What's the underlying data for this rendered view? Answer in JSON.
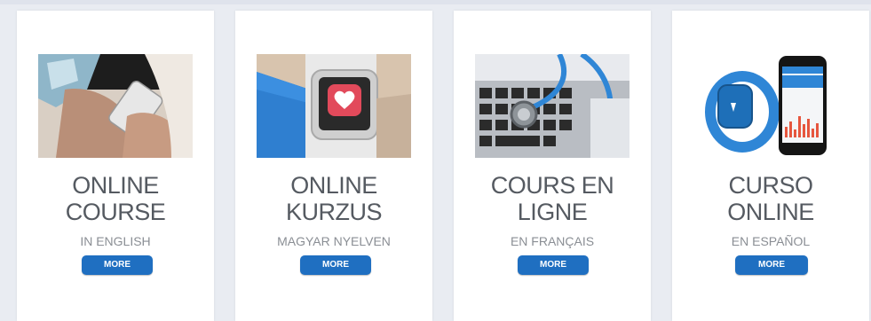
{
  "cards": [
    {
      "line1": "ONLINE",
      "line2": "COURSE",
      "subtitle": "IN ENGLISH",
      "button": "MORE",
      "image": "hands-smartphone"
    },
    {
      "line1": "ONLINE",
      "line2": "KURZUS",
      "subtitle": "MAGYAR NYELVEN",
      "button": "MORE",
      "image": "smartwatch-heart"
    },
    {
      "line1": "COURS EN",
      "line2": "LIGNE",
      "subtitle": "EN FRANÇAIS",
      "button": "MORE",
      "image": "stethoscope-keyboard"
    },
    {
      "line1": "CURSO",
      "line2": "ONLINE",
      "subtitle": "EN ESPAÑOL",
      "button": "MORE",
      "image": "fitness-band-phone"
    }
  ],
  "colors": {
    "accent": "#1f6fc1",
    "title": "#555a61",
    "subtitle": "#8a8e94",
    "background": "#e9ecf2"
  }
}
